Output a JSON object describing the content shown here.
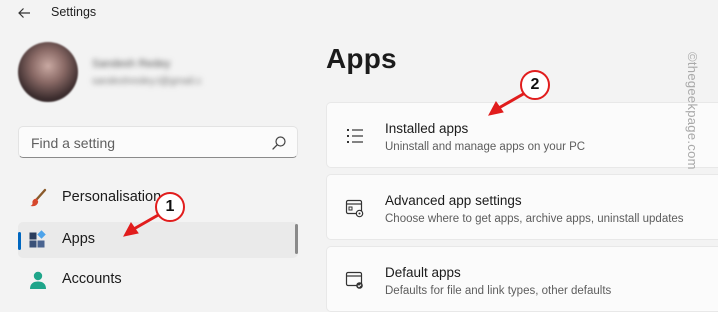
{
  "window": {
    "title": "Settings",
    "back_icon": "arrow-left-icon"
  },
  "profile": {
    "name": "Sandesh Redey",
    "email": "sandeshredey.t@gmail.com"
  },
  "search": {
    "placeholder": "Find a setting",
    "value": ""
  },
  "nav": [
    {
      "label": "Personalisation",
      "icon": "paintbrush-icon",
      "selected": false
    },
    {
      "label": "Apps",
      "icon": "apps-grid-icon",
      "selected": true
    },
    {
      "label": "Accounts",
      "icon": "person-icon",
      "selected": false
    }
  ],
  "content": {
    "title": "Apps",
    "cards": [
      {
        "title": "Installed apps",
        "subtitle": "Uninstall and manage apps on your PC",
        "icon": "list-icon"
      },
      {
        "title": "Advanced app settings",
        "subtitle": "Choose where to get apps, archive apps, uninstall updates",
        "icon": "app-settings-icon"
      },
      {
        "title": "Default apps",
        "subtitle": "Defaults for file and link types, other defaults",
        "icon": "default-apps-icon"
      }
    ]
  },
  "annotations": {
    "marker1": "1",
    "marker2": "2",
    "color": "#e11d1d"
  },
  "watermark": "©thegeekpage.com",
  "colors": {
    "accent": "#0067c0",
    "background": "#f3f3f3",
    "card": "#fbfbfb"
  }
}
